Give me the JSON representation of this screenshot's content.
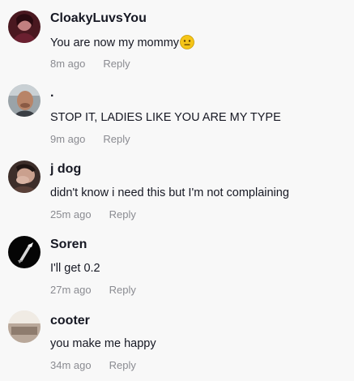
{
  "comments": [
    {
      "username": "CloakyLuvsYou",
      "text": "You are now my mommy",
      "emoji": "neutral-face-emoji",
      "time": "8m ago",
      "reply": "Reply"
    },
    {
      "username": ".",
      "text": "STOP IT, LADIES LIKE YOU ARE MY TYPE",
      "time": "9m ago",
      "reply": "Reply"
    },
    {
      "username": "j dog",
      "text": "didn't know i need this but I'm not complaining",
      "time": "25m ago",
      "reply": "Reply"
    },
    {
      "username": "Soren",
      "text": "I'll get 0.2",
      "time": "27m ago",
      "reply": "Reply"
    },
    {
      "username": "cooter",
      "text": "you make me happy",
      "time": "34m ago",
      "reply": "Reply"
    }
  ],
  "colors": {
    "background": "#f8f8f8",
    "primary_text": "#161823",
    "secondary_text": "#8a8b91",
    "emoji_yellow": "#f5c518"
  }
}
